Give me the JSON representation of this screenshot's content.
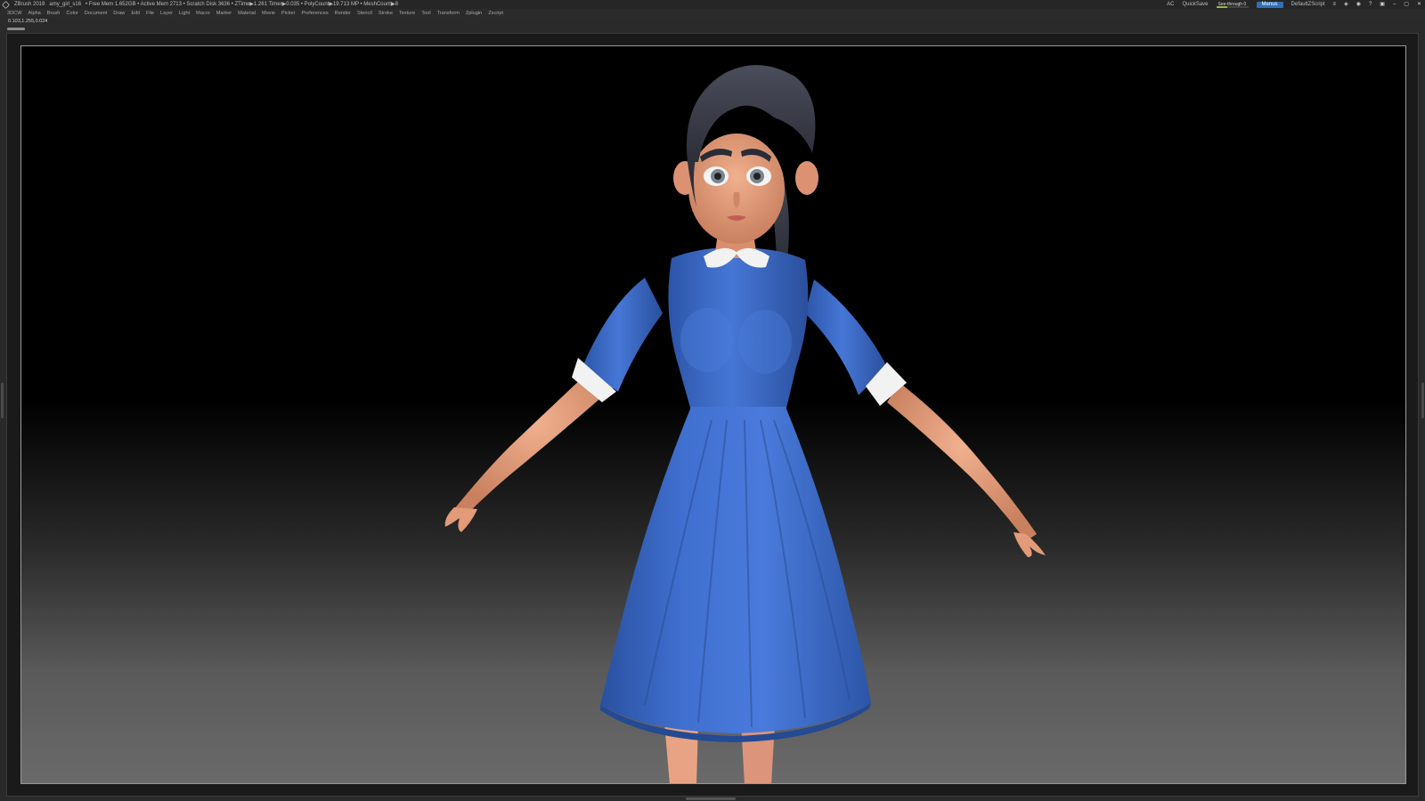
{
  "titlebar": {
    "app": "ZBrush 2019",
    "file": "amy_girl_s16",
    "stats": "• Free Mem 1.652GB • Active Mem 2713 • Scratch Disk 3636 • ZTime▶1.261 Timer▶0.035 • PolyCount▶19.713 MP • MeshCount▶8",
    "ac": "AC",
    "quicksave": "QuickSave",
    "see_through_label": "See-through  0",
    "see_through_value": 0.35,
    "menus_button": "Menus",
    "script": "DefaultZScript"
  },
  "menubar": {
    "items": [
      "3DCW",
      "Alpha",
      "Brush",
      "Color",
      "Document",
      "Draw",
      "Edit",
      "File",
      "Layer",
      "Light",
      "Macro",
      "Marker",
      "Material",
      "Movie",
      "Picker",
      "Preferences",
      "Render",
      "Stencil",
      "Stroke",
      "Texture",
      "Tool",
      "Transform",
      "Zplugin",
      "Zscript"
    ]
  },
  "infobar": {
    "readout": "0.103,1.255,0.024"
  },
  "colors": {
    "dress": "#3a68c4",
    "skin": "#e8a07e",
    "hair": "#3c3e4a",
    "collar": "#f2f2f2",
    "accent": "#2f6fb6"
  }
}
